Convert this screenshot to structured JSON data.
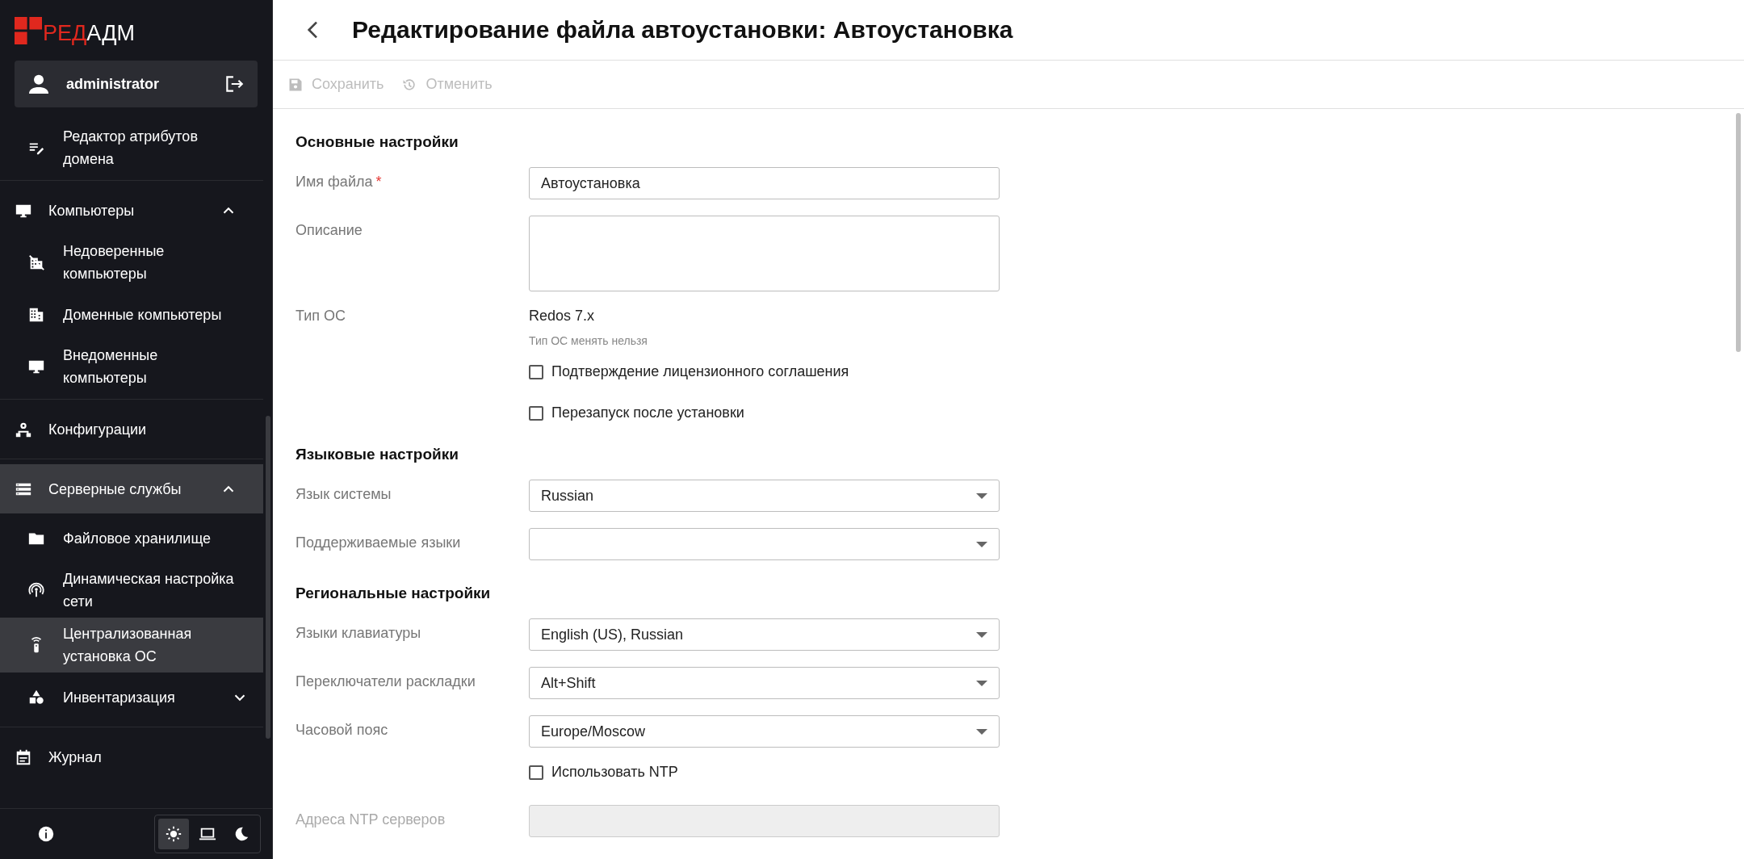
{
  "logo": {
    "part_1": "РЕД",
    "part_2": "АДМ"
  },
  "user": {
    "name": "administrator"
  },
  "sidebar": {
    "sections": [
      {
        "kind": "continued",
        "items": [
          {
            "label": "Редактор атрибутов домена",
            "selected": false
          }
        ]
      },
      {
        "kind": "plain",
        "items": [
          {
            "label": "Компьютеры",
            "selected": false,
            "expanded": true,
            "children": [
              {
                "label": "Недоверенные компьютеры",
                "selected": false
              },
              {
                "label": "Доменные компьютеры",
                "selected": false
              },
              {
                "label": "Внедоменные компьютеры",
                "selected": false
              }
            ]
          }
        ]
      },
      {
        "kind": "plain",
        "items": [
          {
            "label": "Конфигурации",
            "selected": false
          }
        ]
      },
      {
        "kind": "plain",
        "items": [
          {
            "label": "Серверные службы",
            "selected": true,
            "expanded": true,
            "children": [
              {
                "label": "Файловое хранилище",
                "selected": false
              },
              {
                "label": "Динамическая настройка сети",
                "selected": false
              },
              {
                "label": "Централизованная установка ОС",
                "selected": true
              },
              {
                "label": "Инвентаризация",
                "selected": false,
                "expanded": false
              }
            ]
          }
        ]
      },
      {
        "kind": "plain",
        "items": [
          {
            "label": "Журнал",
            "selected": false
          }
        ]
      }
    ]
  },
  "theme_toggle": [
    {
      "selected": true
    },
    {
      "selected": false
    },
    {
      "selected": false
    }
  ],
  "page": {
    "title": "Редактирование файла автоустановки: Автоустановка"
  },
  "toolbar": [
    {
      "label": "Сохранить",
      "disabled": true
    },
    {
      "label": "Отменить",
      "disabled": true
    }
  ],
  "form": {
    "sections": [
      {
        "title": "Основные настройки",
        "fields": [
          {
            "kind": "text",
            "label": "Имя файла",
            "required_mark": "*",
            "value": "Автоустановка"
          },
          {
            "kind": "textarea",
            "label": "Описание"
          },
          {
            "kind": "static",
            "label": "Тип ОС",
            "value": "Redos 7.x",
            "hint": "Тип ОС менять нельзя"
          },
          {
            "kind": "checkbox",
            "label": "Подтверждение лицензионного соглашения",
            "checked": false
          },
          {
            "kind": "checkbox",
            "label": "Перезапуск после установки",
            "checked": false
          }
        ]
      },
      {
        "title": "Языковые настройки",
        "fields": [
          {
            "kind": "select",
            "label": "Язык системы",
            "value": "Russian"
          },
          {
            "kind": "select",
            "label": "Поддерживаемые языки"
          }
        ]
      },
      {
        "title": "Региональные настройки",
        "fields": [
          {
            "kind": "select",
            "label": "Языки клавиатуры",
            "value": "English (US), Russian"
          },
          {
            "kind": "select",
            "label": "Переключатели раскладки",
            "value": "Alt+Shift"
          },
          {
            "kind": "select",
            "label": "Часовой пояс",
            "value": "Europe/Moscow"
          },
          {
            "kind": "checkbox",
            "label": "Использовать NTP",
            "checked": false
          },
          {
            "kind": "text",
            "label": "Адреса NTP серверов",
            "disabled": true
          }
        ]
      }
    ]
  }
}
